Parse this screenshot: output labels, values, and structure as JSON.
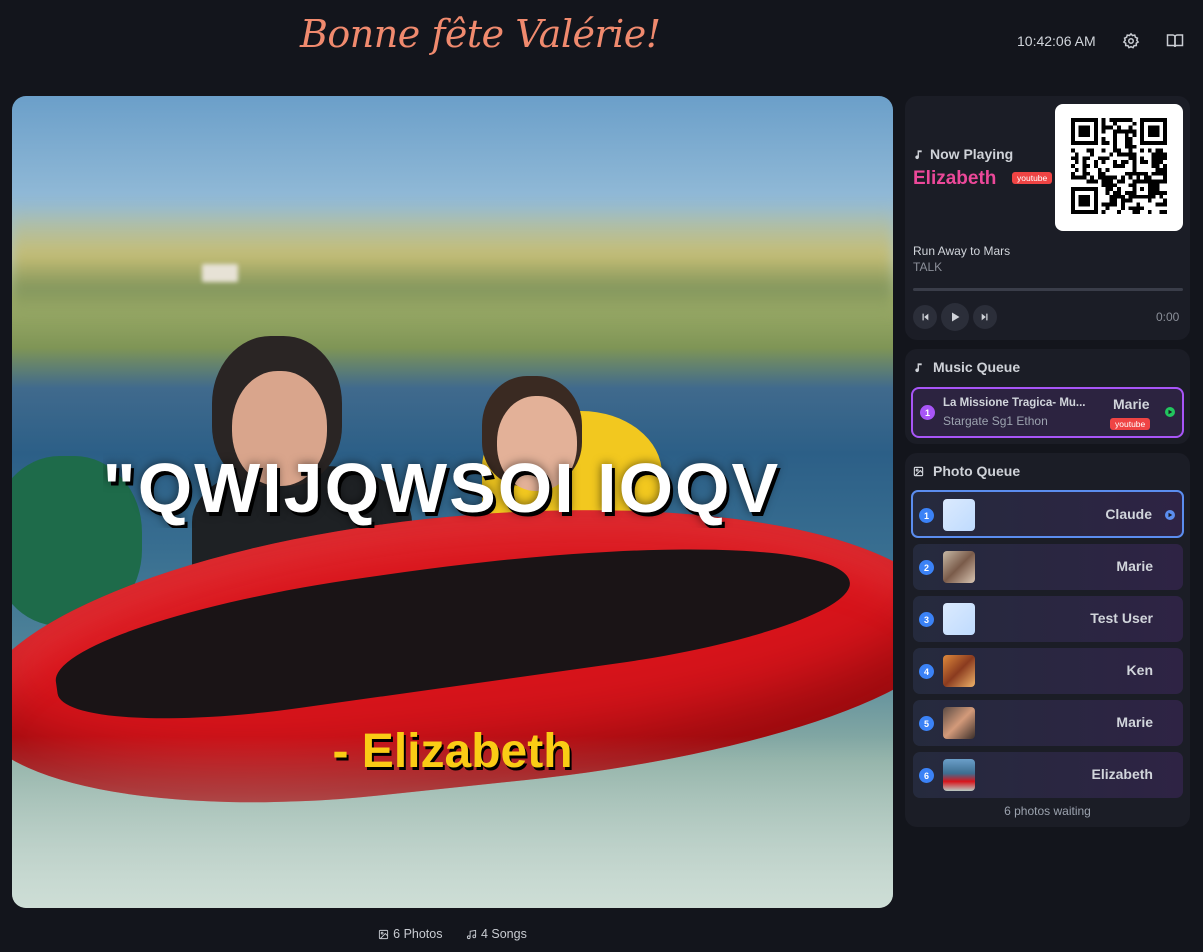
{
  "header": {
    "title": "Bonne fête Valérie!",
    "clock": "10:42:06 AM",
    "icons": [
      "gear-icon",
      "book-icon"
    ]
  },
  "slide": {
    "caption": "\"QWIJQWSOI IOQV",
    "author": "- Elizabeth"
  },
  "footer": {
    "photos_label": "6 Photos",
    "songs_label": "4 Songs"
  },
  "now_playing": {
    "label": "Now Playing",
    "user": "Elizabeth",
    "source": "youtube",
    "song": "Run Away to Mars",
    "artist": "TALK",
    "time": "0:00",
    "progress": 0
  },
  "music_queue": {
    "title": "Music Queue",
    "items": [
      {
        "num": "1",
        "title": "La Missione Tragica- Mu...",
        "artist": "Stargate Sg1 Ethon",
        "user": "Marie",
        "source": "youtube"
      }
    ]
  },
  "photo_queue": {
    "title": "Photo Queue",
    "items": [
      {
        "num": "1",
        "user": "Claude"
      },
      {
        "num": "2",
        "user": "Marie"
      },
      {
        "num": "3",
        "user": "Test User"
      },
      {
        "num": "4",
        "user": "Ken"
      },
      {
        "num": "5",
        "user": "Marie"
      },
      {
        "num": "6",
        "user": "Elizabeth"
      }
    ],
    "waiting": "6 photos waiting"
  },
  "colors": {
    "background": "#13151c",
    "panel": "#1b1d26",
    "title": "#f08a6e",
    "accent_pink": "#ec4899",
    "author_yellow": "#facc15",
    "music_purple": "#a855f7",
    "photo_blue": "#3b82f6",
    "youtube_red": "#ef4444"
  }
}
